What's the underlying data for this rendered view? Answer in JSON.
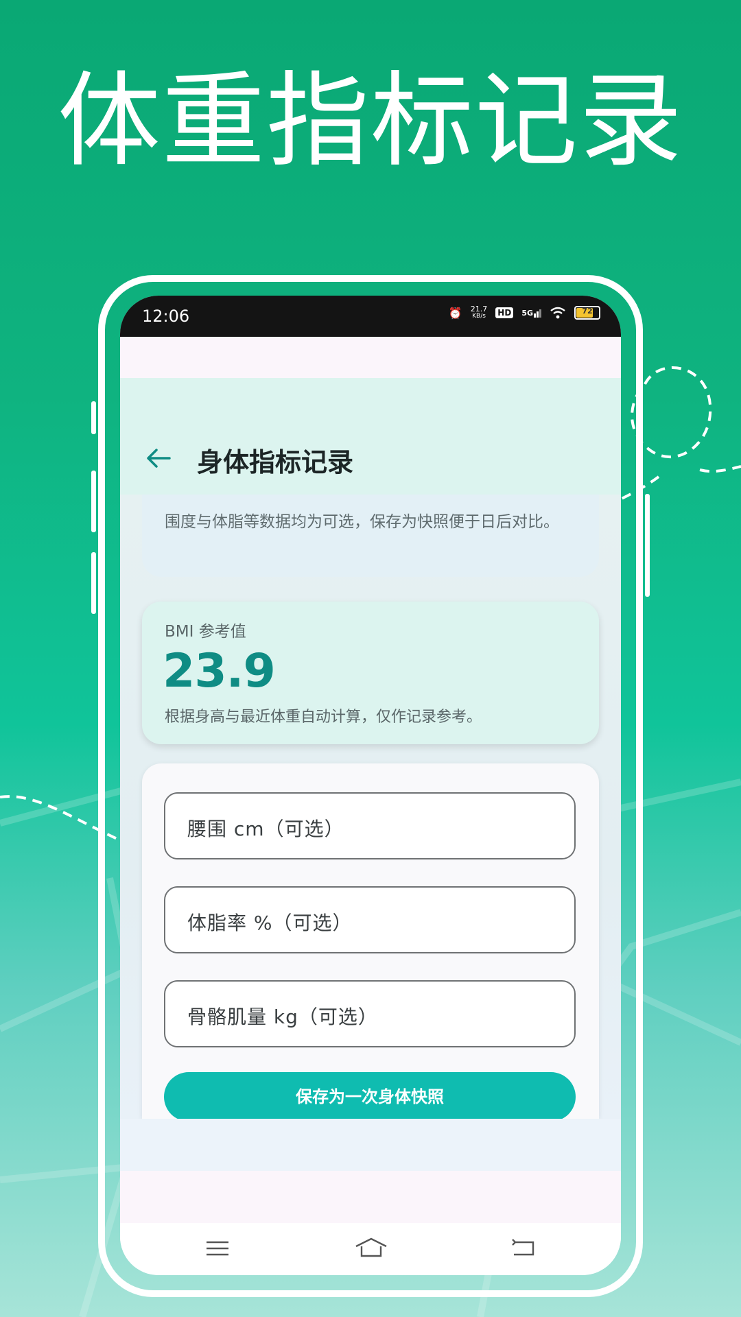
{
  "headline": "体重指标记录",
  "status_bar": {
    "time": "12:06",
    "net_speed_value": "21.7",
    "net_speed_unit": "KB/s",
    "hd": "HD",
    "network": "5G",
    "battery": "72",
    "icons": [
      "alarm-icon",
      "hd-icon",
      "5g-signal-icon",
      "wifi-icon",
      "battery-icon"
    ]
  },
  "header": {
    "title": "身体指标记录",
    "back_icon": "back-arrow-icon"
  },
  "note": {
    "text": "围度与体脂等数据均为可选，保存为快照便于日后对比。"
  },
  "bmi": {
    "label": "BMI 参考值",
    "value": "23.9",
    "description": "根据身高与最近体重自动计算，仅作记录参考。"
  },
  "form": {
    "fields": [
      {
        "placeholder": "腰围 cm（可选）"
      },
      {
        "placeholder": "体脂率 %（可选）"
      },
      {
        "placeholder": "骨骼肌量 kg（可选）"
      }
    ],
    "save_label": "保存为一次身体快照"
  },
  "nav_bar": {
    "icons": [
      "menu-icon",
      "home-icon",
      "back-icon"
    ]
  },
  "colors": {
    "brand_green": "#0aa874",
    "accent_teal": "#0fbcb0",
    "bmi_value": "#0f8c84"
  }
}
